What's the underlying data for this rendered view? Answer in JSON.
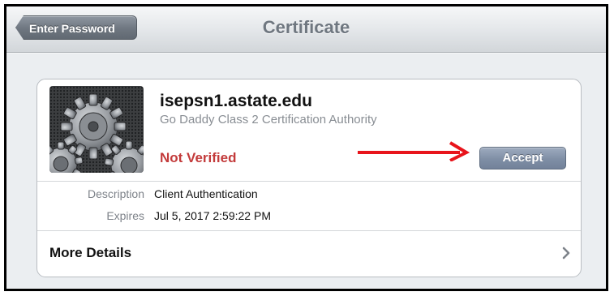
{
  "navbar": {
    "back_label": "Enter Password",
    "title": "Certificate"
  },
  "certificate": {
    "icon": "settings-gear-icon",
    "name": "isepsn1.astate.edu",
    "issuer": "Go Daddy Class 2 Certification Authority",
    "status": "Not Verified",
    "status_color": "#c33b3b",
    "accept_label": "Accept"
  },
  "details": {
    "description_label": "Description",
    "description_value": "Client Authentication",
    "expires_label": "Expires",
    "expires_value": "Jul 5, 2017 2:59:22 PM"
  },
  "more_details": {
    "label": "More Details",
    "icon": "chevron-right-icon"
  },
  "annotation": {
    "icon": "red-arrow-icon",
    "color": "#e8141b"
  }
}
